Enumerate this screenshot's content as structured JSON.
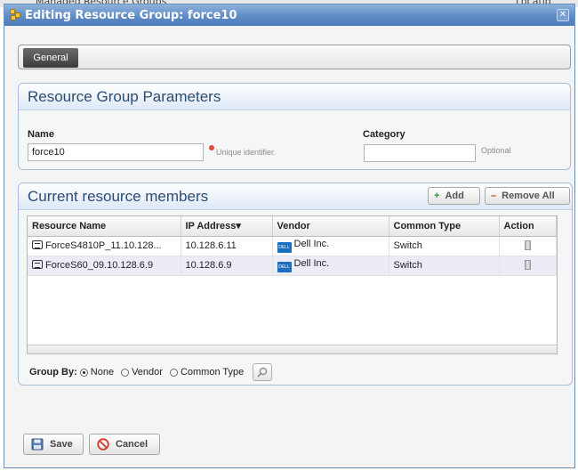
{
  "background": {
    "left_text": "Managed Resource Groups",
    "right_text": "Locatio"
  },
  "dialog": {
    "title": "Editing Resource Group: force10",
    "close_glyph": "✕"
  },
  "tabs": [
    {
      "label": "General",
      "active": true
    }
  ],
  "params_panel": {
    "title": "Resource Group Parameters",
    "name_label": "Name",
    "name_value": "force10",
    "name_hint": "Unique identifier.",
    "category_label": "Category",
    "category_value": "",
    "category_hint": "Optional"
  },
  "members_panel": {
    "title": "Current resource members",
    "add_label": "Add",
    "remove_all_label": "Remove All",
    "columns": [
      "Resource Name",
      "IP Address▾",
      "Vendor",
      "Common Type",
      "Action"
    ],
    "rows": [
      {
        "name": "ForceS4810P_11.10.128...",
        "ip": "10.128.6.11",
        "vendor": "Dell Inc.",
        "type": "Switch"
      },
      {
        "name": "ForceS60_09.10.128.6.9",
        "ip": "10.128.6.9",
        "vendor": "Dell Inc.",
        "type": "Switch"
      }
    ],
    "vendor_logo_text": "DELL",
    "group_by_label": "Group By:",
    "group_by_options": [
      "None",
      "Vendor",
      "Common Type"
    ],
    "group_by_selected": "None"
  },
  "footer": {
    "save_label": "Save",
    "cancel_label": "Cancel"
  },
  "colors": {
    "title_bar": "#5f8cc6",
    "panel_header_text": "#2d4c73",
    "alt_row": "#ececf7"
  }
}
